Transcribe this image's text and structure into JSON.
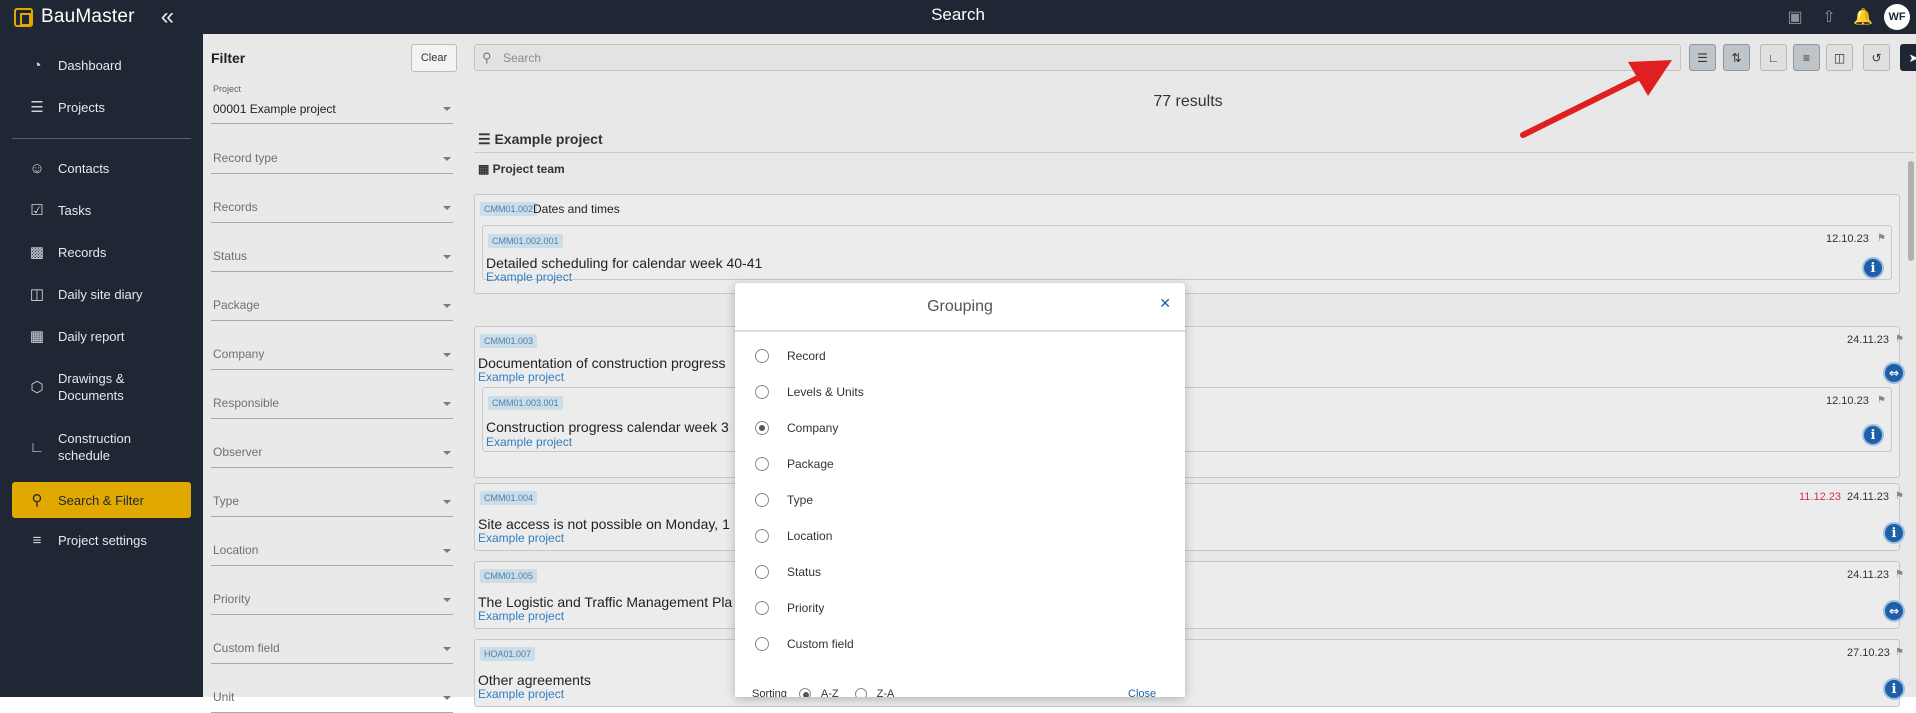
{
  "app": {
    "brand": "BauMaster",
    "collapse_icon": "double-chevron-left-icon",
    "title": "Search",
    "user_initials": "WF"
  },
  "sidebar": {
    "items": [
      {
        "label": "Dashboard",
        "icon": "speedometer-icon"
      },
      {
        "label": "Projects",
        "icon": "list-icon"
      },
      {
        "label": "Contacts",
        "icon": "person-icon"
      },
      {
        "label": "Tasks",
        "icon": "clipboard-check-icon"
      },
      {
        "label": "Records",
        "icon": "calendar-icon"
      },
      {
        "label": "Daily site diary",
        "icon": "document-icon"
      },
      {
        "label": "Daily report",
        "icon": "building-icon"
      },
      {
        "label": "Drawings & Documents",
        "icon": "cube-icon"
      },
      {
        "label": "Construction schedule",
        "icon": "chart-icon"
      },
      {
        "label": "Search & Filter",
        "icon": "search-document-icon",
        "active": true
      },
      {
        "label": "Project settings",
        "icon": "sliders-icon"
      }
    ]
  },
  "filter": {
    "title": "Filter",
    "clear_label": "Clear",
    "project_label": "Project",
    "project_value": "00001 Example project",
    "fields": [
      "Record type",
      "Records",
      "Status",
      "Package",
      "Company",
      "Responsible",
      "Observer",
      "Type",
      "Location",
      "Priority",
      "Custom field",
      "Unit"
    ]
  },
  "main": {
    "search_placeholder": "Search",
    "results_text": "77 results",
    "section_title": "Example project",
    "subsection_title": "Project team",
    "accent_color": "#e1a800",
    "arrow_color": "#e02020",
    "cards": [
      {
        "code": "CMM01.002",
        "title": "Dates and times"
      },
      {
        "code": "CMM01.002.001",
        "title": "Detailed scheduling for calendar week 40-41",
        "project": "Example project",
        "date": "12.10.23"
      },
      {
        "code": "CMM01.003",
        "title": "Documentation of construction progress",
        "project": "Example project",
        "date": "24.11.23"
      },
      {
        "code": "CMM01.003.001",
        "title": "Construction progress calendar week 3",
        "project": "Example project",
        "date": "12.10.23"
      },
      {
        "code": "CMM01.004",
        "title": "Site access is not possible on Monday, 1",
        "project": "Example project",
        "date_due": "11.12.23",
        "date": "24.11.23"
      },
      {
        "code": "CMM01.005",
        "title": "The Logistic and Traffic Management Pla",
        "project": "Example project",
        "date": "24.11.23"
      },
      {
        "code": "HOA01.007",
        "title": "Other agreements",
        "project": "Example project",
        "date": "27.10.23"
      }
    ]
  },
  "modal": {
    "title": "Grouping",
    "close_icon": "close-icon",
    "options": [
      {
        "label": "Record",
        "checked": false
      },
      {
        "label": "Levels & Units",
        "checked": false
      },
      {
        "label": "Company",
        "checked": true
      },
      {
        "label": "Package",
        "checked": false
      },
      {
        "label": "Type",
        "checked": false
      },
      {
        "label": "Location",
        "checked": false
      },
      {
        "label": "Status",
        "checked": false
      },
      {
        "label": "Priority",
        "checked": false
      },
      {
        "label": "Custom field",
        "checked": false
      }
    ],
    "sorting_label": "Sorting",
    "sort_az": "A-Z",
    "sort_za": "Z-A",
    "close_label": "Close"
  }
}
